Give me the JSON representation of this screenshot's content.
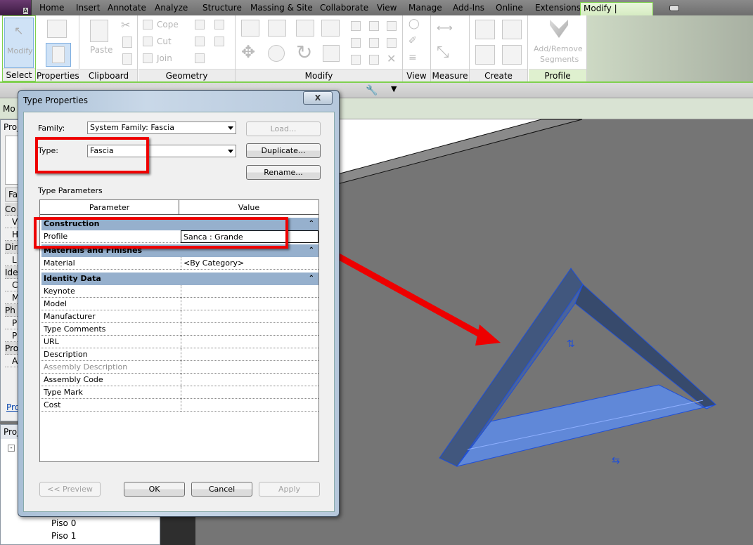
{
  "app": {
    "menu_letter": "A",
    "tabs": [
      "Home",
      "Insert",
      "Annotate",
      "Analyze",
      "Structure",
      "Massing & Site",
      "Collaborate",
      "View",
      "Manage",
      "Add-Ins",
      "Online",
      "Extensions",
      "Modify | Fascias"
    ]
  },
  "ribbon": {
    "panels": {
      "select": "Select",
      "properties": "Properties",
      "clipboard": "Clipboard",
      "geometry": "Geometry",
      "modify": "Modify",
      "view": "View",
      "measure": "Measure",
      "create": "Create",
      "profile": "Profile"
    },
    "modify_button": "Modify",
    "paste": "Paste",
    "cope": "Cope",
    "cut": "Cut",
    "join": "Join",
    "add_remove_1": "Add/Remove",
    "add_remove_2": "Segments"
  },
  "options_bar": {
    "text": "Mo"
  },
  "properties_palette": {
    "title": "Proj",
    "type": "Fas",
    "rows": [
      "Co",
      "V",
      "H",
      "Dir",
      "L",
      "Ide",
      "C",
      "M",
      "Ph",
      "P",
      "P",
      "Pro",
      "A"
    ],
    "link": "Pro"
  },
  "project_browser": {
    "title": "Proj",
    "items": [
      "Piso 0",
      "Piso 1"
    ]
  },
  "dialog": {
    "title": "Type Properties",
    "close": "X",
    "family_label": "Family:",
    "family_value": "System Family: Fascia",
    "type_label": "Type:",
    "type_value": "Fascia",
    "load": "Load...",
    "duplicate": "Duplicate...",
    "rename": "Rename...",
    "section": "Type Parameters",
    "col_parameter": "Parameter",
    "col_value": "Value",
    "groups": {
      "construction": "Construction",
      "materials": "Materials and Finishes",
      "identity": "Identity Data"
    },
    "profile": {
      "name": "Profile",
      "value": "Sanca : Grande"
    },
    "material": {
      "name": "Material",
      "value": "<By Category>"
    },
    "identity_rows": [
      "Keynote",
      "Model",
      "Manufacturer",
      "Type Comments",
      "URL",
      "Description",
      "Assembly Description",
      "Assembly Code",
      "Type Mark",
      "Cost"
    ],
    "preview": "<< Preview",
    "ok": "OK",
    "cancel": "Cancel",
    "apply": "Apply"
  },
  "colors": {
    "highlight": "#ee0000",
    "selection": "#1f4fd8",
    "group_header": "#96b0cd"
  }
}
